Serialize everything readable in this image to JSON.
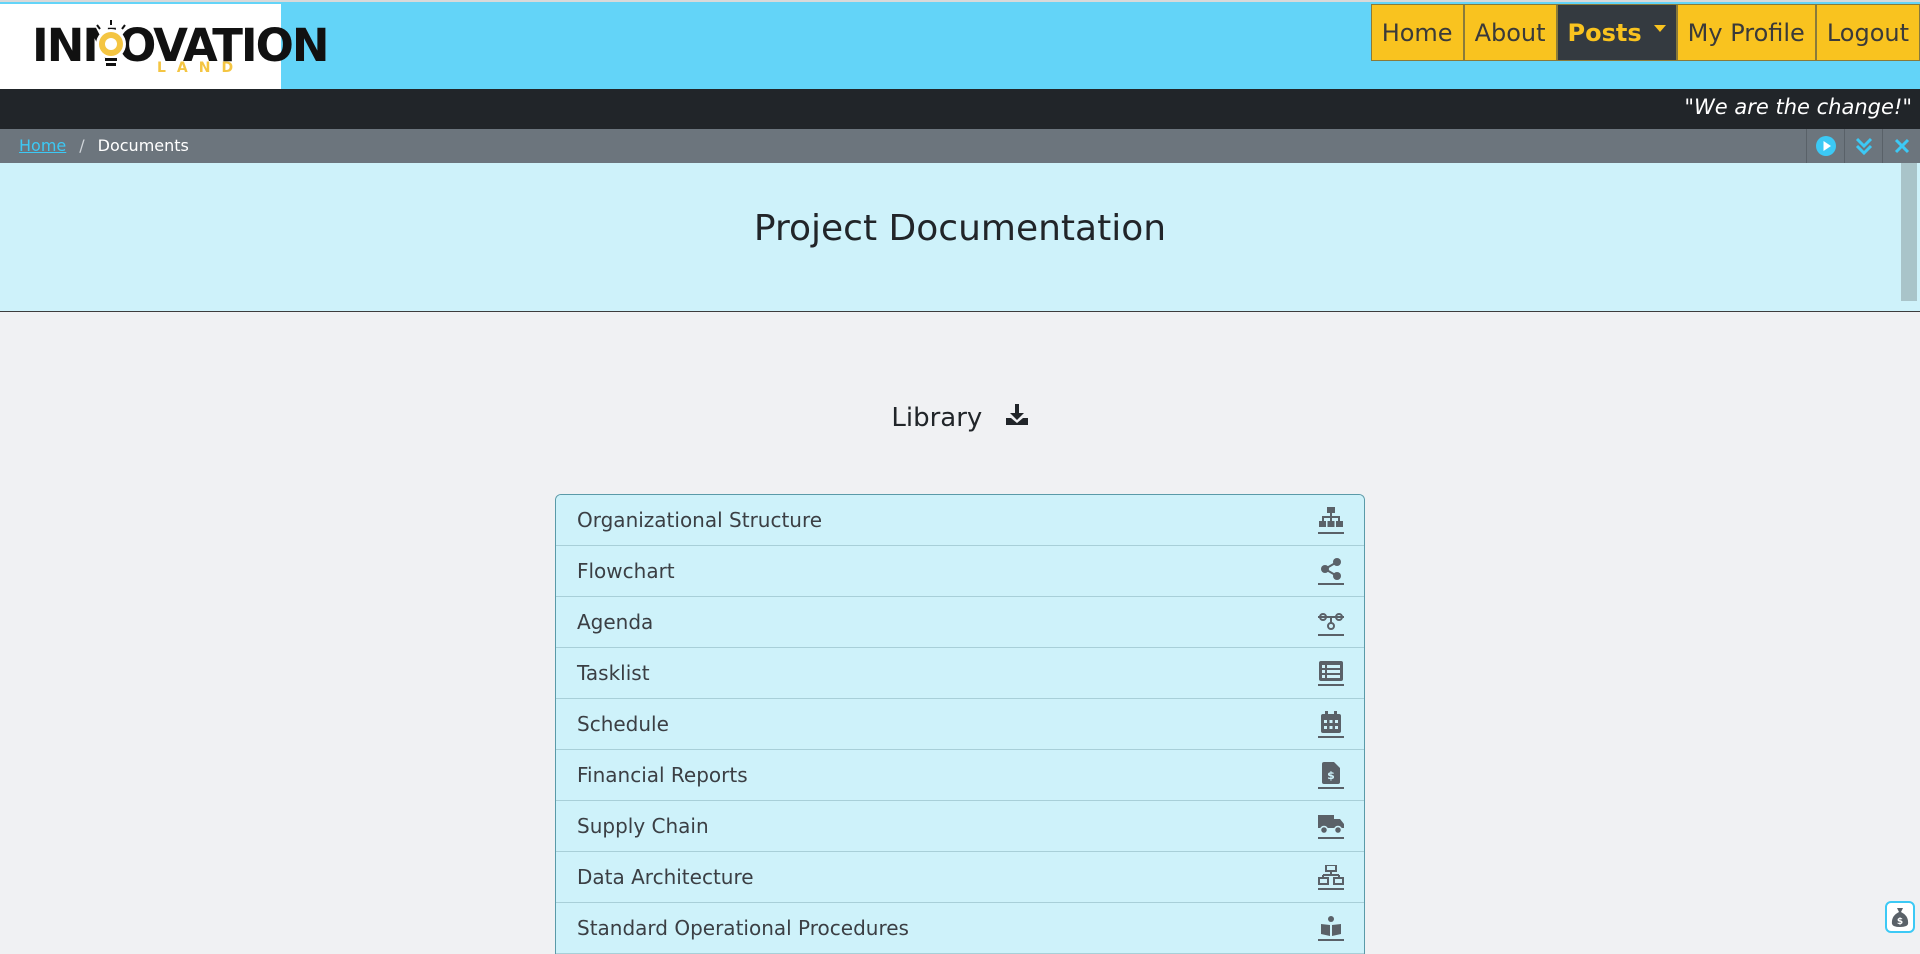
{
  "brand": {
    "logo_text": "INNOVATION",
    "logo_subtext": "LAND"
  },
  "nav": {
    "home": "Home",
    "about": "About",
    "posts": "Posts",
    "profile": "My Profile",
    "logout": "Logout"
  },
  "slogan": "\"We are the change!\"",
  "breadcrumb": {
    "home": "Home",
    "separator": "/",
    "current": "Documents"
  },
  "player_icons": [
    "play-icon",
    "double-chevron-down-icon",
    "close-icon"
  ],
  "page_title": "Project Documentation",
  "library": {
    "heading": "Library",
    "download_icon": "download-icon",
    "items": [
      {
        "label": "Organizational Structure",
        "icon": "sitemap-icon"
      },
      {
        "label": "Flowchart",
        "icon": "share-nodes-icon"
      },
      {
        "label": "Agenda",
        "icon": "timeline-icon"
      },
      {
        "label": "Tasklist",
        "icon": "list-icon"
      },
      {
        "label": "Schedule",
        "icon": "calendar-icon"
      },
      {
        "label": "Financial Reports",
        "icon": "invoice-dollar-icon"
      },
      {
        "label": "Supply Chain",
        "icon": "truck-icon"
      },
      {
        "label": "Data Architecture",
        "icon": "network-icon"
      },
      {
        "label": "Standard Operational Procedures",
        "icon": "book-icon"
      }
    ]
  },
  "colors": {
    "navbar_bg": "#63d4f8",
    "nav_item_bg": "#f9c31f",
    "nav_active_bg": "#343a40",
    "slogan_bg": "#212529",
    "breadcrumb_bg": "#6c757d",
    "header_band_bg": "#cef2fa",
    "page_bg": "#f0f1f3",
    "accent": "#3cc9f5"
  }
}
